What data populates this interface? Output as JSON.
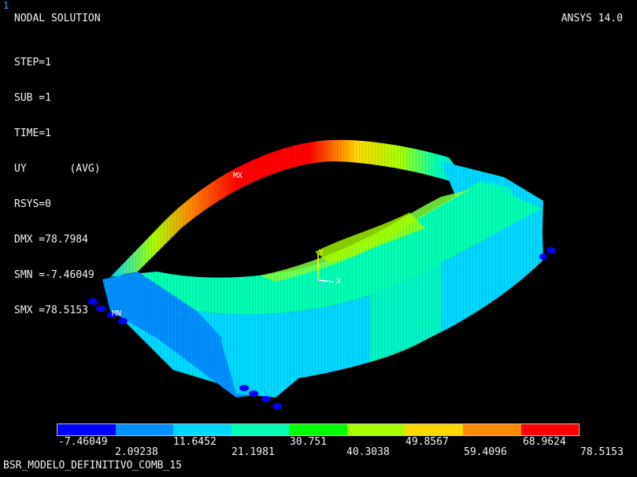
{
  "window_number": "1",
  "title": "NODAL SOLUTION",
  "version": "ANSYS 14.0",
  "params": [
    "STEP=1",
    "SUB =1",
    "TIME=1",
    "UY       (AVG)",
    "RSYS=0",
    "DMX =78.7984",
    "SMN =-7.46049",
    "SMX =78.5153"
  ],
  "markers": {
    "max": "MX",
    "min": "MN"
  },
  "triad": {
    "y": "Y",
    "x": "X"
  },
  "legend": {
    "colors": [
      "#0000ff",
      "#0090ff",
      "#00d8ff",
      "#00ffb4",
      "#00ff00",
      "#a8ff00",
      "#ffd800",
      "#ff8a00",
      "#ff0000"
    ],
    "upper_labels": [
      "-7.46049",
      "11.6452",
      "30.751",
      "49.8567",
      "68.9624"
    ],
    "lower_labels": [
      "2.09238",
      "21.1981",
      "40.3038",
      "59.4096",
      "78.5153"
    ]
  },
  "jobname": "BSR_MODELO_DEFINITIVO_COMB_15"
}
